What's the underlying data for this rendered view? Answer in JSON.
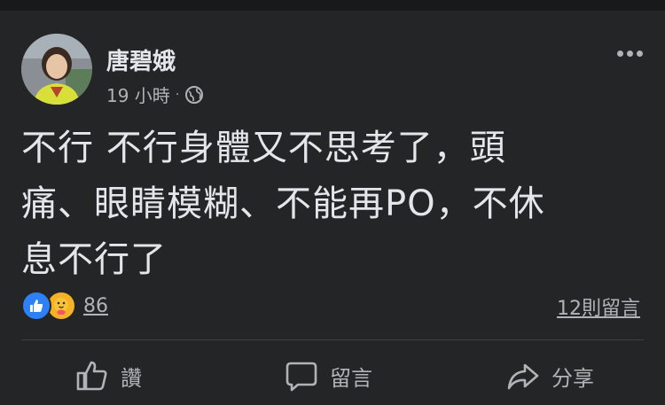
{
  "post": {
    "author": "唐碧娥",
    "time": "19 小時",
    "separator": "·",
    "privacy_icon": "globe-icon",
    "more_icon": "more-options-icon",
    "content_lines": [
      "不行 不行身體又不思考了，頭",
      "痛、眼睛模糊、不能再PO，不休",
      "息不行了"
    ],
    "reactions": {
      "icons": [
        "like-reaction-icon",
        "care-reaction-icon"
      ],
      "count": "86"
    },
    "comments_label": "12則留言"
  },
  "actions": {
    "like_label": "讚",
    "comment_label": "留言",
    "share_label": "分享"
  },
  "colors": {
    "background": "#242526",
    "text": "#e4e6eb",
    "secondary_text": "#b0b3b8",
    "like_blue": "#2e81f4",
    "care_yellow": "#f7b125"
  }
}
